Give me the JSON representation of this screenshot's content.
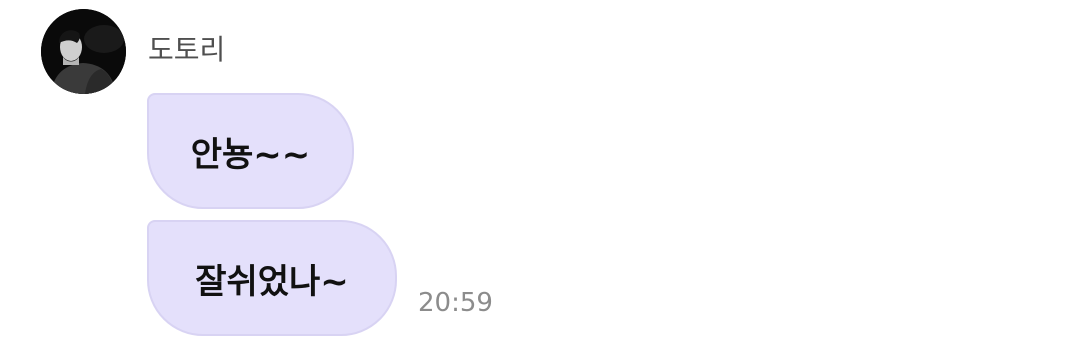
{
  "sender": {
    "name": "도토리",
    "avatar_icon": "profile-photo"
  },
  "messages": [
    {
      "text": "안뇽~~"
    },
    {
      "text": "잘쉬었나~"
    }
  ],
  "timestamp": "20:59",
  "colors": {
    "bubble_background": "#e4e0fb",
    "bubble_border": "#d8d3f3",
    "timestamp_text": "#8c8c8c",
    "name_text": "#4f4f4f"
  }
}
